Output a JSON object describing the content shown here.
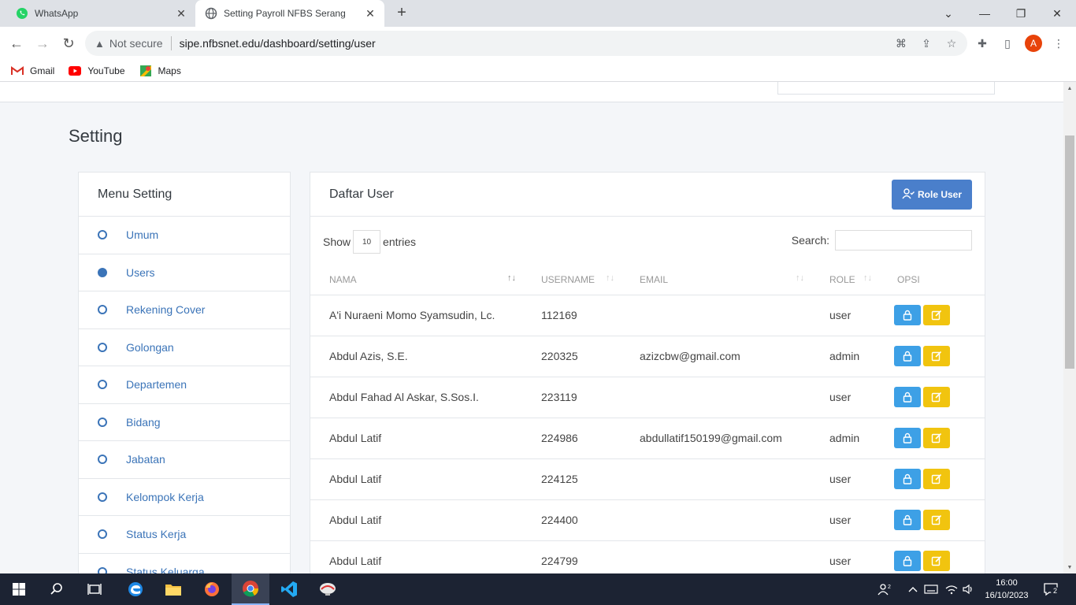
{
  "browser": {
    "tabs": [
      {
        "title": "WhatsApp",
        "active": false,
        "icon": "whatsapp-icon"
      },
      {
        "title": "Setting Payroll NFBS Serang",
        "active": true,
        "icon": "globe-icon"
      }
    ],
    "security_label": "Not secure",
    "url": "sipe.nfbsnet.edu/dashboard/setting/user",
    "profile_initial": "A",
    "bookmarks": [
      {
        "label": "Gmail",
        "icon": "gmail-icon"
      },
      {
        "label": "YouTube",
        "icon": "youtube-icon"
      },
      {
        "label": "Maps",
        "icon": "maps-icon"
      }
    ]
  },
  "page": {
    "title": "Setting",
    "menu": {
      "heading": "Menu Setting",
      "items": [
        {
          "label": "Umum",
          "active": false
        },
        {
          "label": "Users",
          "active": true
        },
        {
          "label": "Rekening Cover",
          "active": false
        },
        {
          "label": "Golongan",
          "active": false
        },
        {
          "label": "Departemen",
          "active": false
        },
        {
          "label": "Bidang",
          "active": false
        },
        {
          "label": "Jabatan",
          "active": false
        },
        {
          "label": "Kelompok Kerja",
          "active": false
        },
        {
          "label": "Status Kerja",
          "active": false
        },
        {
          "label": "Status Keluarga",
          "active": false
        }
      ]
    },
    "users": {
      "heading": "Daftar User",
      "role_button": "Role User",
      "show_label": "Show",
      "entries_value": "10",
      "entries_label": "entries",
      "search_label": "Search:",
      "columns": [
        "NAMA",
        "USERNAME",
        "EMAIL",
        "ROLE",
        "OPSI"
      ],
      "rows": [
        {
          "nama": "A'i Nuraeni Momo Syamsudin, Lc.",
          "username": "112169",
          "email": "",
          "role": "user"
        },
        {
          "nama": "Abdul Azis, S.E.",
          "username": "220325",
          "email": "azizcbw@gmail.com",
          "role": "admin"
        },
        {
          "nama": "Abdul Fahad Al Askar, S.Sos.I.",
          "username": "223119",
          "email": "",
          "role": "user"
        },
        {
          "nama": "Abdul Latif",
          "username": "224986",
          "email": "abdullatif150199@gmail.com",
          "role": "admin"
        },
        {
          "nama": "Abdul Latif",
          "username": "224125",
          "email": "",
          "role": "user"
        },
        {
          "nama": "Abdul Latif",
          "username": "224400",
          "email": "",
          "role": "user"
        },
        {
          "nama": "Abdul Latif",
          "username": "224799",
          "email": "",
          "role": "user"
        }
      ]
    }
  },
  "taskbar": {
    "time": "16:00",
    "date": "16/10/2023",
    "notifications": "2"
  },
  "colors": {
    "primary": "#4a7fcb",
    "lock_button": "#3da0e6",
    "edit_button": "#f1c40f",
    "menu_link": "#3b74b8"
  }
}
